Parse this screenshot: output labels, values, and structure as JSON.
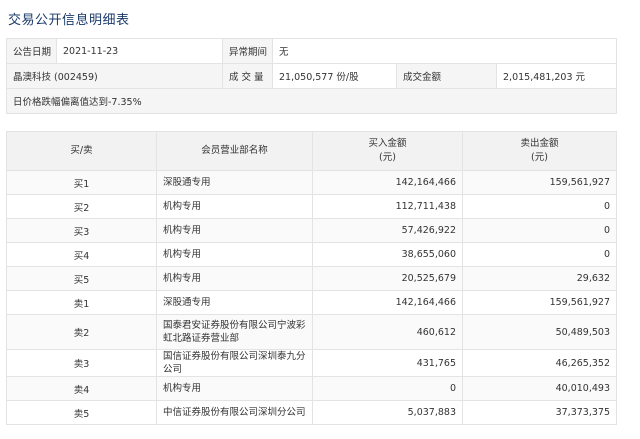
{
  "page": {
    "title": "交易公开信息明细表"
  },
  "info": {
    "announce_date_label": "公告日期",
    "announce_date": "2021-11-23",
    "abnormal_period_label": "异常期间",
    "abnormal_period": "无",
    "stock_name": "晶澳科技 (002459)",
    "volume_label": "成 交 量",
    "volume": "21,050,577 份/股",
    "amount_label": "成交金额",
    "amount": "2,015,481,203 元",
    "note": "日价格跌幅偏离值达到-7.35%"
  },
  "table": {
    "headers": {
      "side": "买/卖",
      "name": "会员营业部名称",
      "buy_line1": "买入金额",
      "buy_line2": "(元)",
      "sell_line1": "卖出金额",
      "sell_line2": "(元)"
    },
    "rows": [
      {
        "side": "买1",
        "name": "深股通专用",
        "buy": "142,164,466",
        "sell": "159,561,927"
      },
      {
        "side": "买2",
        "name": "机构专用",
        "buy": "112,711,438",
        "sell": "0"
      },
      {
        "side": "买3",
        "name": "机构专用",
        "buy": "57,426,922",
        "sell": "0"
      },
      {
        "side": "买4",
        "name": "机构专用",
        "buy": "38,655,060",
        "sell": "0"
      },
      {
        "side": "买5",
        "name": "机构专用",
        "buy": "20,525,679",
        "sell": "29,632"
      },
      {
        "side": "卖1",
        "name": "深股通专用",
        "buy": "142,164,466",
        "sell": "159,561,927"
      },
      {
        "side": "卖2",
        "name": "国泰君安证券股份有限公司宁波彩虹北路证券营业部",
        "buy": "460,612",
        "sell": "50,489,503"
      },
      {
        "side": "卖3",
        "name": "国信证券股份有限公司深圳泰九分公司",
        "buy": "431,765",
        "sell": "46,265,352"
      },
      {
        "side": "卖4",
        "name": "机构专用",
        "buy": "0",
        "sell": "40,010,493"
      },
      {
        "side": "卖5",
        "name": "中信证券股份有限公司深圳分公司",
        "buy": "5,037,883",
        "sell": "37,373,375"
      }
    ]
  }
}
